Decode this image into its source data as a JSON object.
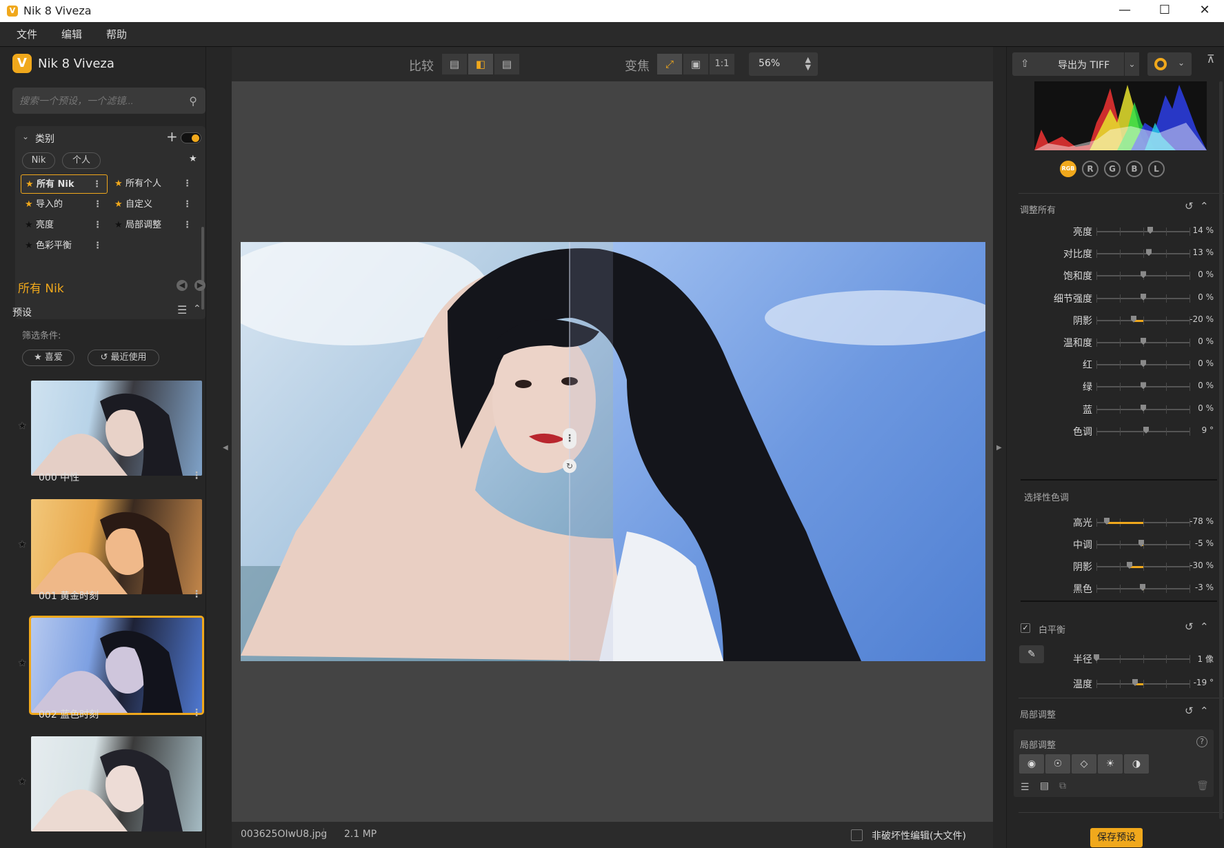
{
  "window": {
    "title": "Nik 8 Viveza",
    "logo_letter": "V",
    "minimize": "—",
    "maximize": "☐",
    "close": "✕"
  },
  "menu": [
    "文件",
    "编辑",
    "帮助"
  ],
  "left": {
    "brand": "Nik 8 Viveza",
    "search_placeholder": "搜索一个预设，一个滤镜...",
    "category_title": "类别",
    "chips": [
      "Nik",
      "个人"
    ],
    "categories": [
      {
        "label": "所有 Nik",
        "star": "gold",
        "selected": true
      },
      {
        "label": "所有个人",
        "star": "gold"
      },
      {
        "label": "导入的",
        "star": "gold"
      },
      {
        "label": "自定义",
        "star": "gold"
      },
      {
        "label": "亮度",
        "star": "dark"
      },
      {
        "label": "局部调整",
        "star": "dark"
      },
      {
        "label": "色彩平衡",
        "star": "dark"
      }
    ],
    "current_collection": "所有 Nik",
    "presets_title": "预设",
    "filter_label": "筛选条件:",
    "filter_favorite": "喜爱",
    "filter_recent": "最近使用",
    "presets": [
      {
        "label": "000 中性",
        "tint": "neutral"
      },
      {
        "label": "001 黄金时刻",
        "tint": "gold"
      },
      {
        "label": "002 蓝色时刻",
        "tint": "blue",
        "selected": true
      },
      {
        "label": "",
        "tint": "soft"
      }
    ]
  },
  "toolbar": {
    "compare_label": "比较",
    "zoom_label": "变焦",
    "one_to_one": "1:1",
    "zoom_value": "56%"
  },
  "status": {
    "filename": "003625OIwU8.jpg",
    "megapixels": "2.1 MP",
    "nondestructive": "非破坏性编辑(大文件)"
  },
  "right": {
    "export_label": "导出为 TIFF",
    "channels": [
      "RGB",
      "R",
      "G",
      "B",
      "L"
    ],
    "adjust_all_title": "调整所有",
    "adjust_all": [
      {
        "label": "亮度",
        "value": "14 %",
        "pos": 0.57,
        "fill": 0
      },
      {
        "label": "对比度",
        "value": "13 %",
        "pos": 0.56,
        "fill": 0
      },
      {
        "label": "饱和度",
        "value": "0 %",
        "pos": 0.5,
        "fill": 0
      },
      {
        "label": "细节强度",
        "value": "0 %",
        "pos": 0.5,
        "fill": 0
      },
      {
        "label": "阴影",
        "value": "-20 %",
        "pos": 0.4,
        "fill": 1
      },
      {
        "label": "温和度",
        "value": "0 %",
        "pos": 0.5,
        "fill": 0
      },
      {
        "label": "红",
        "value": "0 %",
        "pos": 0.5,
        "fill": 0
      },
      {
        "label": "绿",
        "value": "0 %",
        "pos": 0.5,
        "fill": 0
      },
      {
        "label": "蓝",
        "value": "0 %",
        "pos": 0.5,
        "fill": 0
      },
      {
        "label": "色调",
        "value": "9 °",
        "pos": 0.53,
        "fill": 0
      }
    ],
    "selective_title": "选择性色调",
    "selective": [
      {
        "label": "高光",
        "value": "-78 %",
        "pos": 0.11,
        "fill": 1
      },
      {
        "label": "中调",
        "value": "-5 %",
        "pos": 0.48,
        "fill": 1
      },
      {
        "label": "阴影",
        "value": "-30 %",
        "pos": 0.35,
        "fill": 1
      },
      {
        "label": "黑色",
        "value": "-3 %",
        "pos": 0.49,
        "fill": 1
      }
    ],
    "wb_title": "白平衡",
    "wb": [
      {
        "label": "半径",
        "value": "1 像",
        "pos": 0.0,
        "fill": 0
      },
      {
        "label": "温度",
        "value": "-19 °",
        "pos": 0.41,
        "fill": 1
      }
    ],
    "local_title": "局部调整",
    "local_sub": "局部调整",
    "save_preset": "保存预设"
  },
  "colors": {
    "accent": "#f0a81c",
    "panel": "#262626",
    "canvas": "#444444"
  }
}
